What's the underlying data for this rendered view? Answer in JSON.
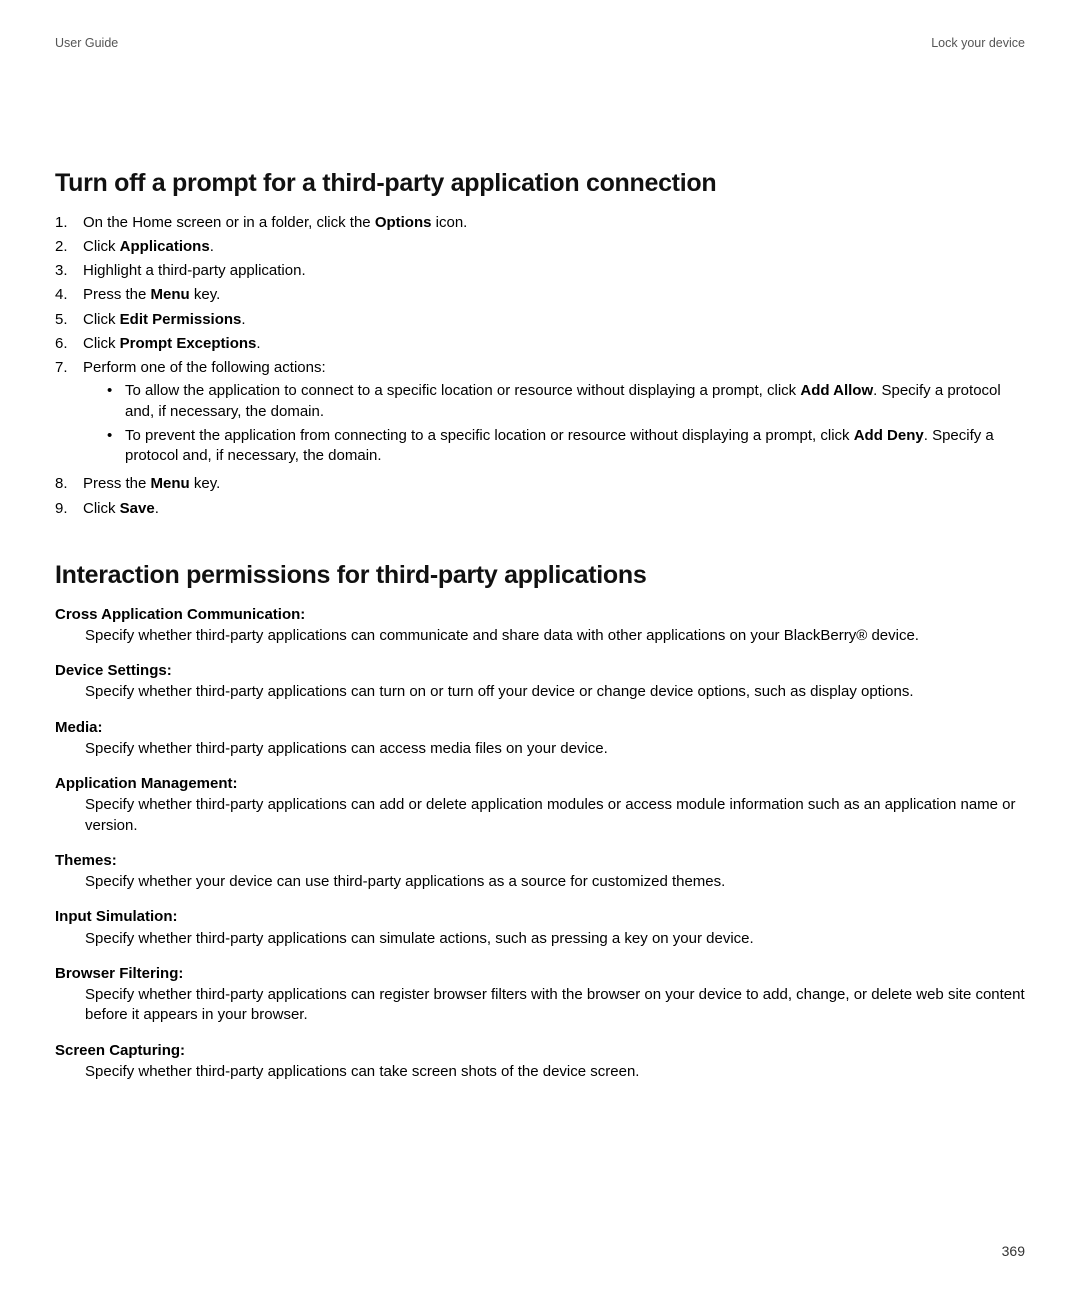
{
  "header": {
    "left": "User Guide",
    "right": "Lock your device"
  },
  "section1": {
    "title": "Turn off a prompt for a third-party application connection",
    "steps": [
      {
        "num": "1.",
        "pre": "On the Home screen or in a folder, click the ",
        "bold": "Options",
        "post": " icon."
      },
      {
        "num": "2.",
        "pre": "Click ",
        "bold": "Applications",
        "post": "."
      },
      {
        "num": "3.",
        "pre": "Highlight a third-party application.",
        "bold": "",
        "post": ""
      },
      {
        "num": "4.",
        "pre": "Press the ",
        "bold": "Menu",
        "post": " key."
      },
      {
        "num": "5.",
        "pre": "Click ",
        "bold": "Edit Permissions",
        "post": "."
      },
      {
        "num": "6.",
        "pre": "Click ",
        "bold": "Prompt Exceptions",
        "post": "."
      },
      {
        "num": "7.",
        "pre": "Perform one of the following actions:",
        "bold": "",
        "post": "",
        "sub": [
          {
            "pre": "To allow the application to connect to a specific location or resource without displaying a prompt, click ",
            "bold": "Add Allow",
            "post": ". Specify a protocol and, if necessary, the domain."
          },
          {
            "pre": "To prevent the application from connecting to a specific location or resource without displaying a prompt, click ",
            "bold": "Add Deny",
            "post": ". Specify a protocol and, if necessary, the domain."
          }
        ]
      },
      {
        "num": "8.",
        "pre": "Press the ",
        "bold": "Menu",
        "post": " key."
      },
      {
        "num": "9.",
        "pre": "Click ",
        "bold": "Save",
        "post": "."
      }
    ]
  },
  "section2": {
    "title": "Interaction permissions for third-party applications",
    "defs": [
      {
        "term": "Cross Application Communication:",
        "desc": "Specify whether third-party applications can communicate and share data with other applications on your BlackBerry® device."
      },
      {
        "term": "Device Settings:",
        "desc": "Specify whether third-party applications can turn on or turn off your device or change device options, such as display options."
      },
      {
        "term": "Media:",
        "desc": "Specify whether third-party applications can access media files on your device."
      },
      {
        "term": "Application Management:",
        "desc": "Specify whether third-party applications can add or delete application modules or access module information such as an application name or version."
      },
      {
        "term": "Themes:",
        "desc": "Specify whether your device can use third-party applications as a source for customized themes."
      },
      {
        "term": "Input Simulation:",
        "desc": "Specify whether third-party applications can simulate actions, such as pressing a key on your device."
      },
      {
        "term": "Browser Filtering:",
        "desc": "Specify whether third-party applications can register browser filters with the browser on your device to add, change, or delete web site content before it appears in your browser."
      },
      {
        "term": "Screen Capturing:",
        "desc": "Specify whether third-party applications can take screen shots of the device screen."
      }
    ]
  },
  "pageNum": "369"
}
